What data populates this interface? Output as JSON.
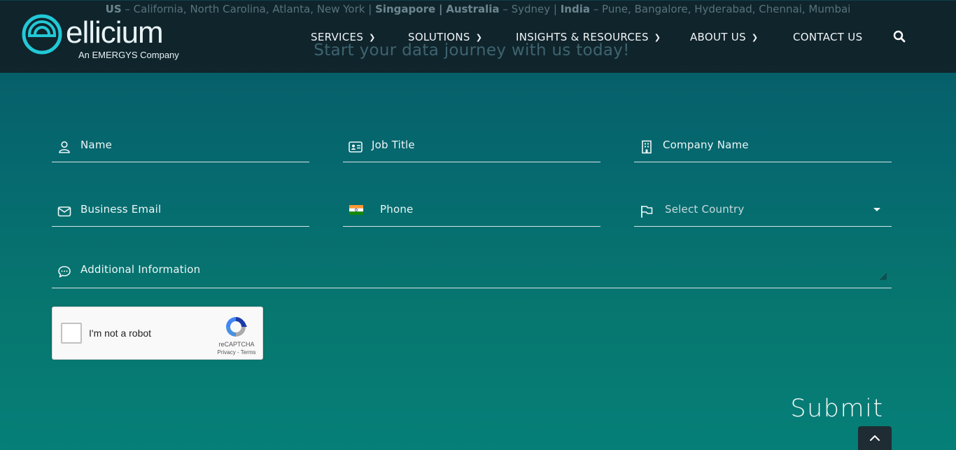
{
  "locations_bar": {
    "us_label": "US",
    "us_text": "– California, North Carolina, Atlanta, New York |",
    "sg_label": "Singapore",
    "sep1": "|",
    "au_label": "Australia",
    "au_text": "– Sydney |",
    "in_label": "India",
    "in_text": "– Pune, Bangalore, Hyderabad, Chennai, Mumbai"
  },
  "tagline": "Start your data journey with us today!",
  "brand": {
    "name": "ellicium",
    "subtitle": "An EMERGYS Company",
    "accent": "#22c9d6"
  },
  "nav": {
    "items": [
      {
        "label": "SERVICES",
        "has_dropdown": true
      },
      {
        "label": "SOLUTIONS",
        "has_dropdown": true
      },
      {
        "label": "INSIGHTS & RESOURCES",
        "has_dropdown": true
      },
      {
        "label": "ABOUT US",
        "has_dropdown": true
      },
      {
        "label": "CONTACT US",
        "has_dropdown": false
      }
    ],
    "search_icon": "search-icon"
  },
  "form": {
    "name_placeholder": "Name",
    "job_title_placeholder": "Job Title",
    "company_placeholder": "Company Name",
    "email_placeholder": "Business Email",
    "phone_placeholder": "Phone",
    "country_placeholder": "Select Country",
    "info_placeholder": "Additional Information",
    "phone_flag": "india-flag-icon",
    "submit_label": "Submit"
  },
  "captcha": {
    "checkbox_label": "I'm not a robot",
    "brand": "reCAPTCHA",
    "links": "Privacy - Terms"
  },
  "colors": {
    "header_bg": "#112028",
    "field_line": "#d7e6e8",
    "page_bg_top": "#065866",
    "page_bg_bottom": "#057f78"
  }
}
